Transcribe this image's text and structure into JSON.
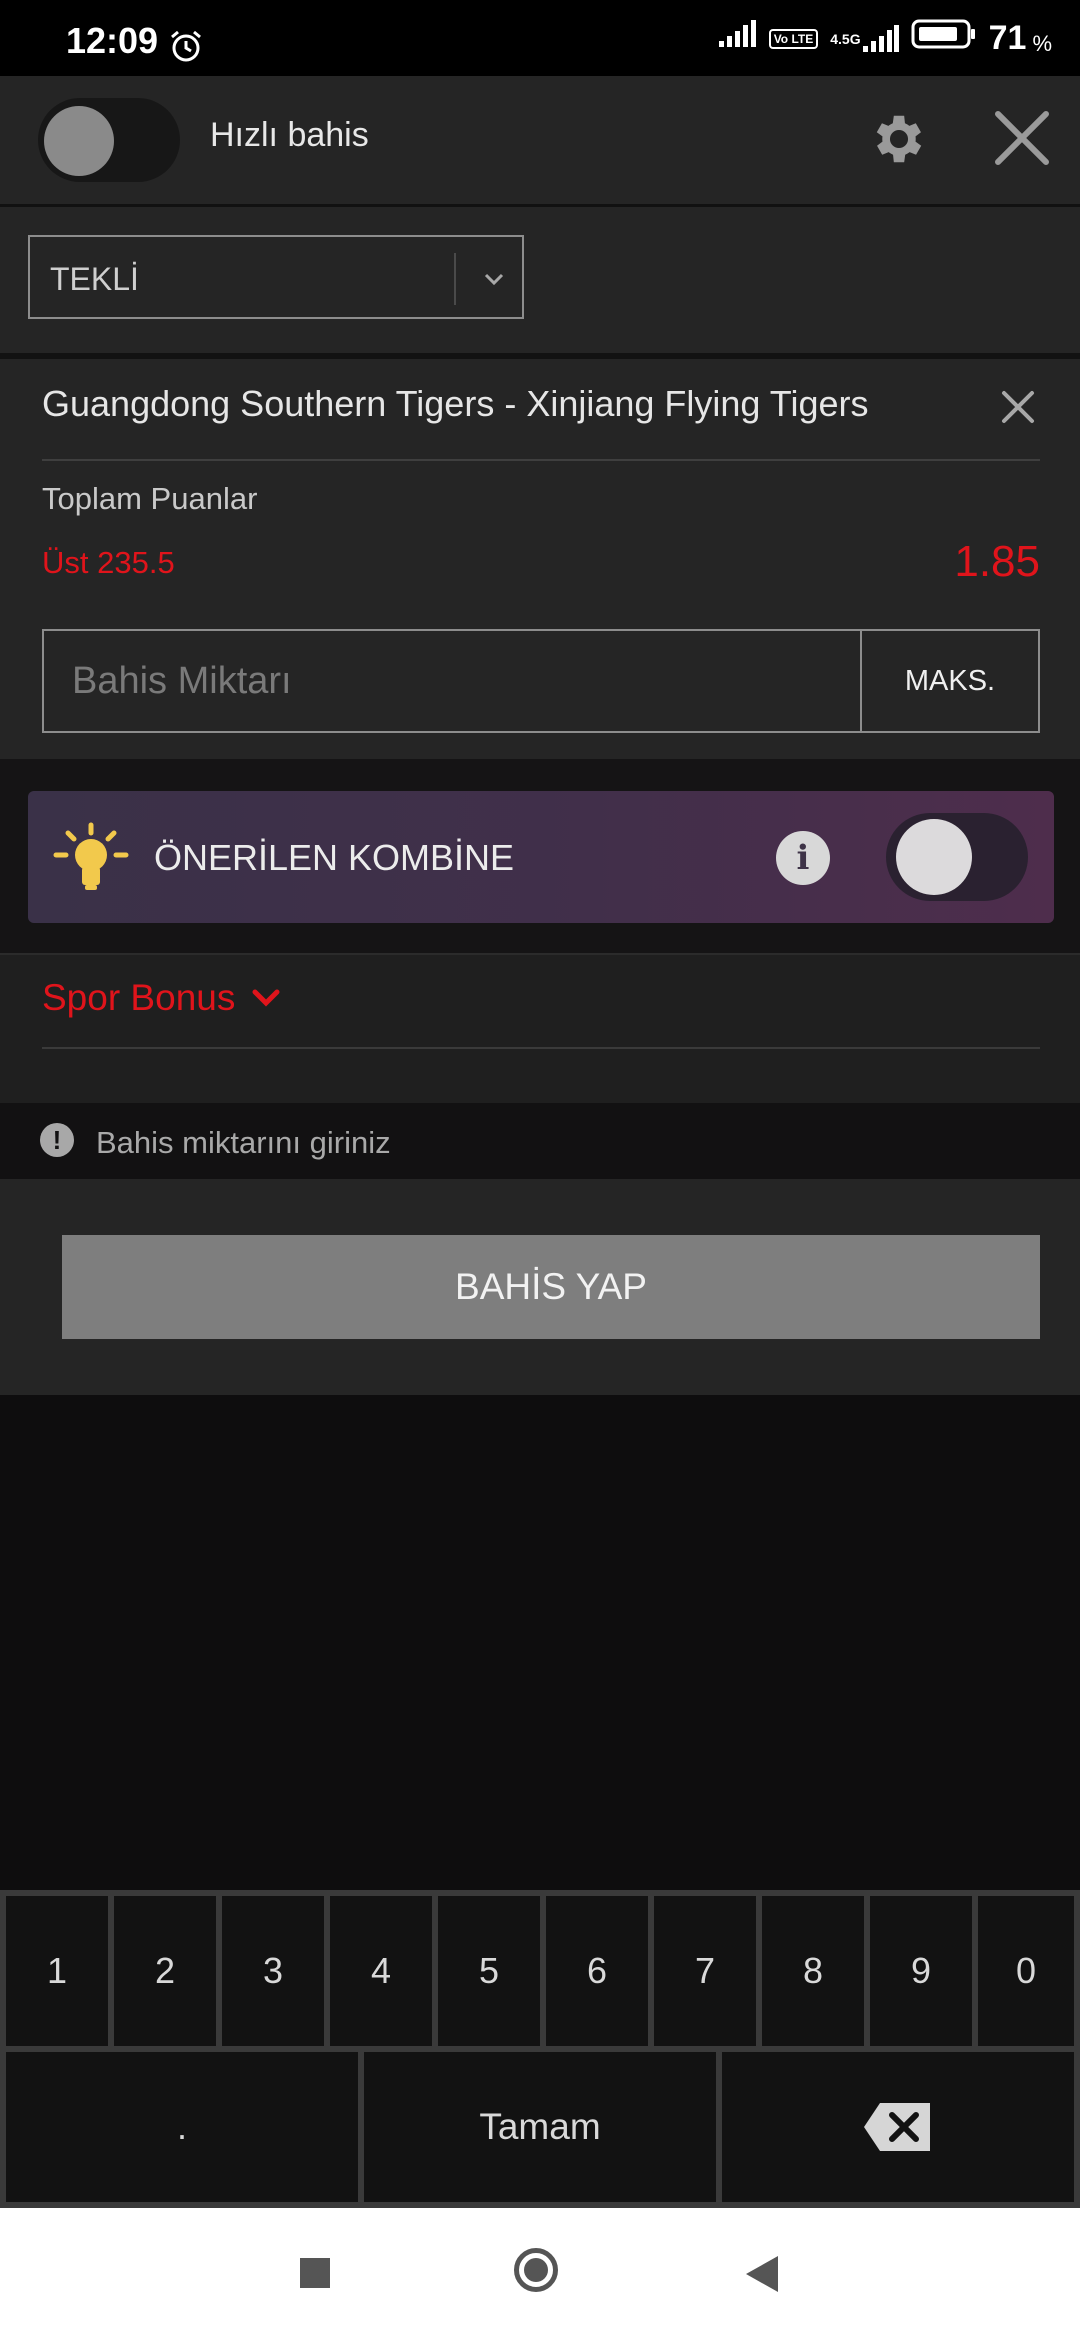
{
  "status_bar": {
    "time": "12:09",
    "volte_label": "Vo LTE",
    "network_label": "4.5G",
    "battery_percent": "71",
    "percent_sign": "%"
  },
  "header": {
    "quick_bet_label": "Hızlı bahis",
    "quick_bet_on": false
  },
  "bet_type": {
    "selected": "TEKLİ"
  },
  "bet": {
    "match": "Guangdong Southern Tigers - Xinjiang Flying Tigers",
    "market": "Toplam Puanlar",
    "selection": "Üst 235.5",
    "odds": "1.85",
    "stake_placeholder": "Bahis Miktarı",
    "max_label": "MAKS."
  },
  "recommended": {
    "label": "ÖNERİLEN KOMBİNE",
    "info_glyph": "i",
    "enabled": true
  },
  "bonus": {
    "label": "Spor Bonus"
  },
  "warning": {
    "glyph": "!",
    "text": "Bahis miktarını giriniz"
  },
  "submit": {
    "label": "BAHİS YAP"
  },
  "keypad": {
    "digits": [
      "1",
      "2",
      "3",
      "4",
      "5",
      "6",
      "7",
      "8",
      "9",
      "0"
    ],
    "dot": ".",
    "done": "Tamam"
  },
  "colors": {
    "accent_red": "#e0141b",
    "panel": "#252525",
    "background": "#0e0d0e",
    "submit_disabled": "#7e7e7e"
  }
}
